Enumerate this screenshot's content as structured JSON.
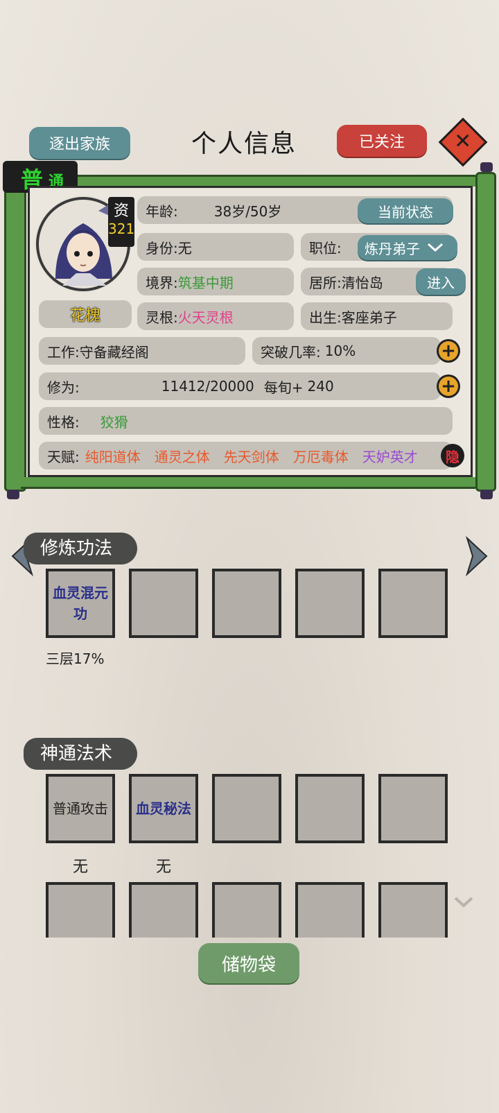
{
  "header": {
    "expel_label": "逐出家族",
    "title": "个人信息",
    "follow_label": "已关注",
    "close_icon": "close-icon"
  },
  "rank": {
    "char1": "普",
    "char2": "通"
  },
  "character": {
    "name": "花槐",
    "aptitude_label": "资",
    "aptitude_value": "321",
    "age_label": "年龄:",
    "age_value": "38岁/50岁",
    "status_button": "当前状态",
    "identity_label": "身份:",
    "identity_value": "无",
    "position_label": "职位:",
    "position_value": "炼丹弟子",
    "realm_label": "境界:",
    "realm_value": "筑基中期",
    "residence_label": "居所:",
    "residence_value": "清怡岛",
    "enter_button": "进入",
    "root_label": "灵根:",
    "root_value": "火天灵根",
    "birth_label": "出生:",
    "birth_value": "客座弟子",
    "work_label": "工作:",
    "work_value": "守备藏经阁",
    "breakthrough_label": "突破几率:",
    "breakthrough_value": "10%",
    "cultivation_label": "修为:",
    "cultivation_value": "11412/20000",
    "per_turn_label": "每旬+",
    "per_turn_value": "240",
    "personality_label": "性格:",
    "personality_value": "狡猾",
    "talent_label": "天赋:",
    "talents": [
      "纯阳道体",
      "通灵之体",
      "先天剑体",
      "万厄毒体",
      "天妒英才"
    ],
    "hide_label": "隐"
  },
  "colors": {
    "realm": "#3a9a3a",
    "root": "#e0408a",
    "personality": "#3a9a3a",
    "talent_orange": "#e8582c",
    "talent_purple": "#9a4ad0",
    "rank_green": "#2fd12f"
  },
  "techniques": {
    "title": "修炼功法",
    "slots": [
      {
        "name": "血灵混元功",
        "progress": "三层17%"
      },
      {
        "name": "",
        "progress": ""
      },
      {
        "name": "",
        "progress": ""
      },
      {
        "name": "",
        "progress": ""
      },
      {
        "name": "",
        "progress": ""
      }
    ]
  },
  "spells": {
    "title": "神通法术",
    "row1": [
      {
        "name": "普通攻击",
        "sub": "无"
      },
      {
        "name": "血灵秘法",
        "sub": "无"
      },
      {
        "name": "",
        "sub": ""
      },
      {
        "name": "",
        "sub": ""
      },
      {
        "name": "",
        "sub": ""
      }
    ]
  },
  "storage_label": "储物袋"
}
